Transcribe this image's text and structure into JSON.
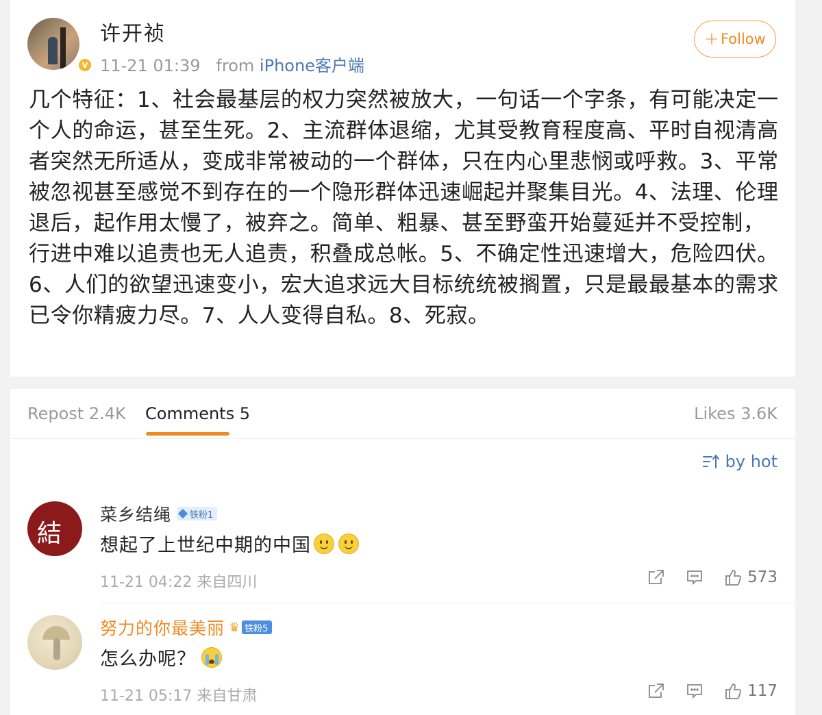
{
  "post": {
    "author": "许开祯",
    "time": "11-21 01:39",
    "from_label": "from",
    "source": "iPhone客户端",
    "follow_label": "Follow",
    "verified_icon": "verified-v-icon",
    "text": "几个特征：1、社会最基层的权力突然被放大，一句话一个字条，有可能决定一个人的命运，甚至生死。2、主流群体退缩，尤其受教育程度高、平时自视清高者突然无所适从，变成非常被动的一个群体，只在内心里悲悯或呼救。3、平常被忽视甚至感觉不到存在的一个隐形群体迅速崛起并聚集目光。4、法理、伦理退后，起作用太慢了，被弃之。简单、粗暴、甚至野蛮开始蔓延并不受控制，行进中难以追责也无人追责，积叠成总帐。5、不确定性迅速增大，危险四伏。6、人们的欲望迅速变小，宏大追求远大目标统统被搁置，只是最最基本的需求已令你精疲力尽。7、人人变得自私。8、死寂。"
  },
  "tabs": {
    "repost": "Repost 2.4K",
    "comments": "Comments 5",
    "likes": "Likes 3.6K"
  },
  "sort": {
    "label": "by hot"
  },
  "comments": [
    {
      "name": "菜乡结绳",
      "badge": "铁粉1",
      "text": "想起了上世纪中期的中国",
      "emoji": [
        "smile",
        "smile"
      ],
      "meta": "11-21 04:22 来自四川",
      "likes": "573"
    },
    {
      "name": "努力的你最美丽",
      "badge": "铁粉5",
      "text": "怎么办呢？",
      "emoji": [
        "cry"
      ],
      "meta": "11-21 05:17 来自甘肃",
      "likes": "117"
    }
  ],
  "colors": {
    "accent_orange": "#f08a24",
    "link_blue": "#4a78b4",
    "muted_gray": "#999999"
  }
}
